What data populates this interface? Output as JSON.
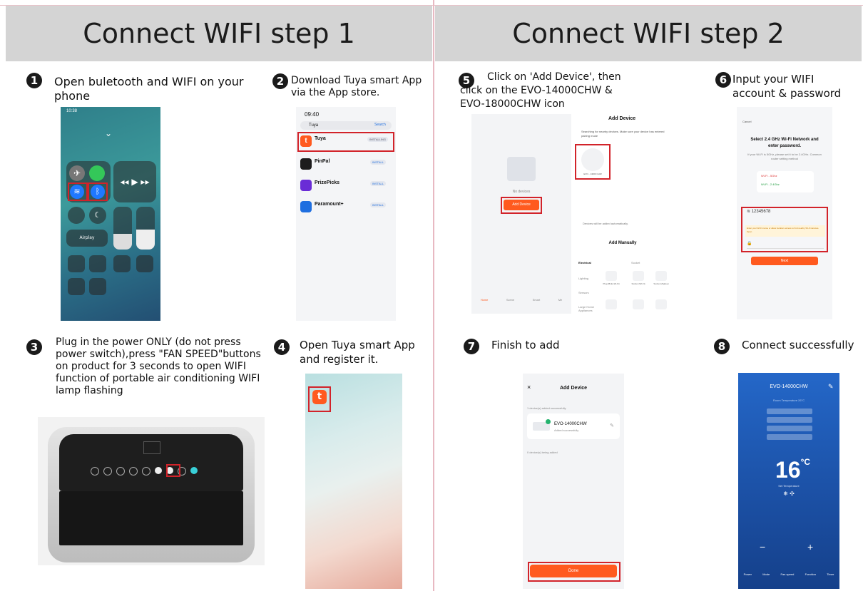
{
  "header_left": "Connect WIFI step 1",
  "header_right": "Connect WIFI step 2",
  "steps": {
    "s1": {
      "n": "1",
      "text": "Open buletooth and WIFI on your phone"
    },
    "s2": {
      "n": "2",
      "text": "Download Tuya smart App via the App store."
    },
    "s3": {
      "n": "3",
      "text": "Plug in the power ONLY (do not press power switch),press \"FAN SPEED\"buttons on product for 3 seconds to open WIFI function of portable air conditioning WIFI lamp flashing"
    },
    "s4": {
      "n": "4",
      "text": "Open Tuya smart App and register it."
    },
    "s5": {
      "n": "5",
      "text": "Click on 'Add Device', then click on the EVO-14000CHW & EVO-18000CHW icon"
    },
    "s6": {
      "n": "6",
      "text": "Input your WIFI account & password"
    },
    "s7": {
      "n": "7",
      "text": "Finish to add"
    },
    "s8": {
      "n": "8",
      "text": "Connect successfully"
    }
  },
  "control_center": {
    "time": "10:38",
    "airplay": "Airplay"
  },
  "appstore": {
    "time": "09:40",
    "search": "Tuya",
    "search_btn": "Search",
    "apps": [
      {
        "name": "Tuya",
        "btn": "INSTALLING",
        "color": "#ff5a1f"
      },
      {
        "name": "PinPal",
        "btn": "INSTALL",
        "color": "#1c1c1c"
      },
      {
        "name": "PrizePicks",
        "btn": "INSTALL",
        "color": "#6a2cd6"
      },
      {
        "name": "Paramount+",
        "btn": "INSTALL",
        "color": "#1f6fe0"
      }
    ]
  },
  "tuya_home": {
    "no_devices": "No devices",
    "add_device": "Add Device",
    "nav": [
      "Home",
      "Scene",
      "Smart",
      "Me"
    ]
  },
  "add_device": {
    "title": "Add Device",
    "searching": "Searching for nearby devices. Make sure your device has entered pairing mode",
    "device_label": "EVO - 14000 CHW",
    "auto_text": "Devices will be added automatically.",
    "add_manually": "Add Manually",
    "electrical": "Electrical",
    "socket": "Socket",
    "categories": [
      "Lighting",
      "Sensors",
      "Large Home Appliances"
    ],
    "plug_labels": [
      "Plug (BLE+Wi-Fi)",
      "Socket (Wi-Fi)",
      "Socket (Zigbee)"
    ]
  },
  "wifi_screen": {
    "cancel": "Cancel",
    "title": "Select 2.4 GHz Wi-Fi Network and enter password.",
    "note": "If your Wi-Fi is 5GHz, please set it to be 2.4GHz. Common router setting method",
    "net1": "Wi-Fi - 5Ghz",
    "net2": "Wi-Fi - 2.4Ghz",
    "ssid": "12345678",
    "warn": "Enter your Wi-Fi name or allow location access to find nearby Wi-Fi devices. Open",
    "next": "Next"
  },
  "finish_screen": {
    "title": "Add Device",
    "added_line": "1 device(s) added successfully",
    "device_name": "EVO-14000CHW",
    "device_sub": "Added successfully",
    "being_added": "0 device(s) being added",
    "done": "Done"
  },
  "success_screen": {
    "device": "EVO-14000CHW",
    "room": "Room Temperature 26°C",
    "temp": "16",
    "unit": "°C",
    "set": "Set Temperature",
    "minus": "−",
    "plus": "+",
    "nav": [
      "Power",
      "Mode",
      "Fan speed",
      "Function",
      "Timer"
    ]
  },
  "colors": {
    "tuya_orange": "#ff5a1f",
    "red_box": "#d2232a",
    "header_bg": "#d4d4d4",
    "blue_app": "#1f6fe0"
  }
}
